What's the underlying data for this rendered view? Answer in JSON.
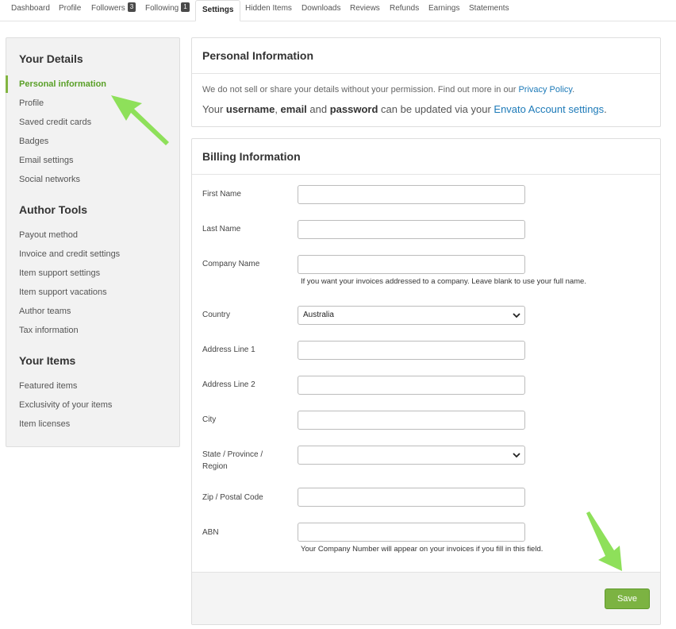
{
  "tabs": [
    {
      "label": "Dashboard"
    },
    {
      "label": "Profile"
    },
    {
      "label": "Followers",
      "count": "3"
    },
    {
      "label": "Following",
      "count": "1"
    },
    {
      "label": "Settings",
      "active": true
    },
    {
      "label": "Hidden Items"
    },
    {
      "label": "Downloads"
    },
    {
      "label": "Reviews"
    },
    {
      "label": "Refunds"
    },
    {
      "label": "Earnings"
    },
    {
      "label": "Statements"
    }
  ],
  "sidebar": {
    "sections": [
      {
        "heading": "Your Details",
        "items": [
          "Personal information",
          "Profile",
          "Saved credit cards",
          "Badges",
          "Email settings",
          "Social networks"
        ]
      },
      {
        "heading": "Author Tools",
        "items": [
          "Payout method",
          "Invoice and credit settings",
          "Item support settings",
          "Item support vacations",
          "Author teams",
          "Tax information"
        ]
      },
      {
        "heading": "Your Items",
        "items": [
          "Featured items",
          "Exclusivity of your items",
          "Item licenses"
        ]
      }
    ],
    "active_item": "Personal information"
  },
  "personal": {
    "title": "Personal Information",
    "notice_text": "We do not sell or share your details without your permission. Find out more in our ",
    "privacy_link": "Privacy Policy",
    "period": ".",
    "update_prefix": "Your ",
    "username": "username",
    "comma": ", ",
    "email": "email",
    "and": " and ",
    "password": "password",
    "update_suffix": " can be updated via your ",
    "account_link": "Envato Account settings",
    "period2": "."
  },
  "billing": {
    "title": "Billing Information",
    "fields": {
      "first_name": {
        "label": "First Name",
        "value": ""
      },
      "last_name": {
        "label": "Last Name",
        "value": ""
      },
      "company_name": {
        "label": "Company Name",
        "value": "",
        "hint": "If you want your invoices addressed to a company. Leave blank to use your full name."
      },
      "country": {
        "label": "Country",
        "value": "Australia"
      },
      "address1": {
        "label": "Address Line 1",
        "value": ""
      },
      "address2": {
        "label": "Address Line 2",
        "value": ""
      },
      "city": {
        "label": "City",
        "value": ""
      },
      "state": {
        "label": "State / Province / Region",
        "value": ""
      },
      "zip": {
        "label": "Zip / Postal Code",
        "value": ""
      },
      "abn": {
        "label": "ABN",
        "value": "",
        "hint": "Your Company Number will appear on your invoices if you fill in this field."
      }
    },
    "save_label": "Save"
  },
  "colors": {
    "accent_green": "#7cb342",
    "link_blue": "#1d7ab8",
    "arrow_green": "#8ee05a"
  }
}
